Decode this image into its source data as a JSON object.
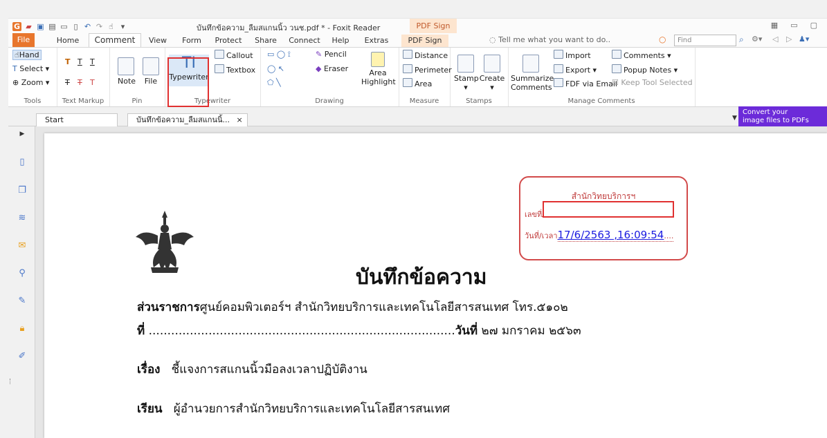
{
  "window": {
    "title": "บันทึกข้อความ_ลืมสแกนนิ้ว วนช.pdf * - Foxit Reader",
    "context_tab_header": "PDF Sign",
    "find_placeholder": "Find"
  },
  "tabs": [
    "File",
    "Home",
    "Comment",
    "View",
    "Form",
    "Protect",
    "Share",
    "Connect",
    "Help",
    "Extras",
    "PDF Sign"
  ],
  "tell_me": "Tell me what you want to do..",
  "ribbon": {
    "tools": {
      "hand": "Hand",
      "select": "Select",
      "zoom": "Zoom",
      "label": "Tools"
    },
    "text_markup": {
      "label": "Text Markup"
    },
    "pin": {
      "note": "Note",
      "file": "File",
      "label": "Pin"
    },
    "typewriter": {
      "typewriter": "Typewriter",
      "callout": "Callout",
      "textbox": "Textbox",
      "label": "Typewriter"
    },
    "drawing": {
      "pencil": "Pencil",
      "eraser": "Eraser",
      "area_highlight_1": "Area",
      "area_highlight_2": "Highlight",
      "label": "Drawing"
    },
    "measure": {
      "distance": "Distance",
      "perimeter": "Perimeter",
      "area": "Area",
      "label": "Measure"
    },
    "stamps": {
      "stamp": "Stamp",
      "create": "Create",
      "label": "Stamps"
    },
    "manage": {
      "summarize_1": "Summarize",
      "summarize_2": "Comments",
      "import": "Import",
      "export": "Export",
      "fdf_email": "FDF via Email",
      "comments": "Comments",
      "popup_notes": "Popup Notes",
      "keep_tool": "Keep Tool Selected",
      "label": "Manage Comments"
    }
  },
  "doc_tabs": {
    "start": "Start",
    "current": "บันทึกข้อความ_ลืมสแกนนิ้..."
  },
  "promo": {
    "line1": "Convert your",
    "line2": "image files to PDFs"
  },
  "document": {
    "stamp_office": "สำนักวิทยบริการฯ",
    "stamp_no_label": "เลขที่",
    "stamp_time_label": "วันที่/เวลา",
    "stamp_timestamp": "17/6/2563 ,16:09:54",
    "memo_title": "บันทึกข้อความ",
    "agency_label": "ส่วนราชการ",
    "agency_value": "ศูนย์คอมพิวเตอร์ฯ สำนักวิทยบริการและเทคโนโลยีสารสนเทศ โทร.๕๑๐๒",
    "ref_label": "ที่",
    "ref_dots": "..................................................................................",
    "date_label": "วันที่",
    "date_value": "๒๗ มกราคม ๒๕๖๓",
    "subject_label": "เรื่อง",
    "subject_value": "ชี้แจงการสแกนนิ้วมือลงเวลาปฏิบัติงาน",
    "to_label": "เรียน",
    "to_value": "ผู้อำนวยการสำนักวิทยบริการและเทคโนโลยีสารสนเทศ"
  }
}
